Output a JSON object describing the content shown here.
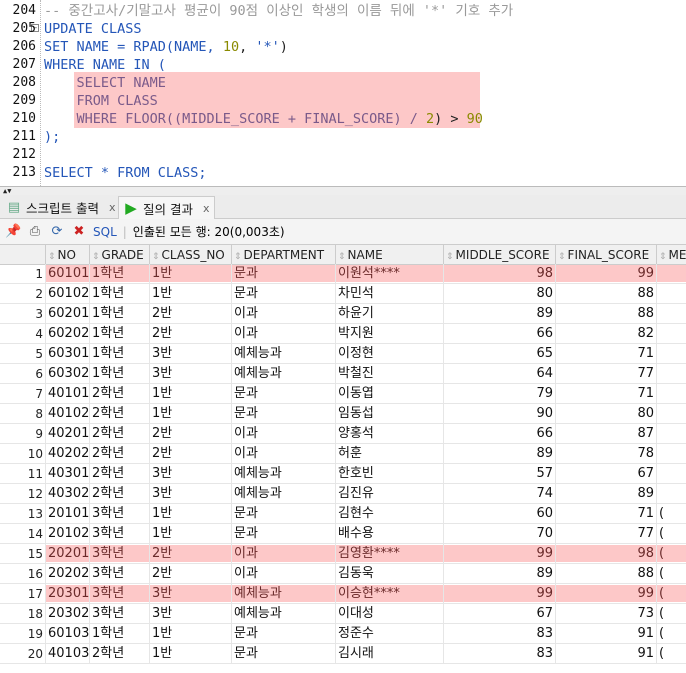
{
  "editor": {
    "lines": [
      {
        "n": "204",
        "text": "-- 중간고사/기말고사 평균이 90점 이상인 학생의 이름 뒤에 '*' 기호 추가"
      },
      {
        "n": "205",
        "text": "UPDATE CLASS"
      },
      {
        "n": "206",
        "a": "SET NAME = RPAD(NAME, ",
        "b": "10",
        ",": ", ",
        "c": "'*'",
        "d": ")"
      },
      {
        "n": "207",
        "text": "WHERE NAME IN ("
      },
      {
        "n": "208",
        "text": "    SELECT NAME"
      },
      {
        "n": "209",
        "text": "    FROM CLASS"
      },
      {
        "n": "210",
        "a": "    WHERE FLOOR((MIDDLE_SCORE + FINAL_SCORE) / ",
        "b": "2",
        ",": ") > ",
        "c": "90"
      },
      {
        "n": "211",
        "text": ");"
      },
      {
        "n": "212",
        "text": ""
      },
      {
        "n": "213",
        "text": "SELECT * FROM CLASS;"
      }
    ],
    "highlight_color": "#fdc8c8"
  },
  "tabs": [
    {
      "label": "스크립트 출력",
      "icon": "script-output-icon",
      "close": "x"
    },
    {
      "label": "질의 결과",
      "icon": "run-icon",
      "close": "x",
      "active": true
    }
  ],
  "toolbar": {
    "sql_label": "SQL",
    "status": "인출된 모든 행: 20(0,003초)"
  },
  "grid": {
    "columns": [
      "NO",
      "GRADE",
      "CLASS_NO",
      "DEPARTMENT",
      "NAME",
      "MIDDLE_SCORE",
      "FINAL_SCORE",
      "ME"
    ],
    "rows": [
      [
        "1",
        "60101",
        "1학년",
        "1반",
        "문과",
        "이원석****",
        "98",
        "99",
        ""
      ],
      [
        "2",
        "60102",
        "1학년",
        "1반",
        "문과",
        "차민석",
        "80",
        "88",
        ""
      ],
      [
        "3",
        "60201",
        "1학년",
        "2반",
        "이과",
        "하윤기",
        "89",
        "88",
        ""
      ],
      [
        "4",
        "60202",
        "1학년",
        "2반",
        "이과",
        "박지원",
        "66",
        "82",
        ""
      ],
      [
        "5",
        "60301",
        "1학년",
        "3반",
        "예체능과",
        "이정현",
        "65",
        "71",
        ""
      ],
      [
        "6",
        "60302",
        "1학년",
        "3반",
        "예체능과",
        "박철진",
        "64",
        "77",
        ""
      ],
      [
        "7",
        "40101",
        "2학년",
        "1반",
        "문과",
        "이동엽",
        "79",
        "71",
        ""
      ],
      [
        "8",
        "40102",
        "2학년",
        "1반",
        "문과",
        "임동섭",
        "90",
        "80",
        ""
      ],
      [
        "9",
        "40201",
        "2학년",
        "2반",
        "이과",
        "양홍석",
        "66",
        "87",
        ""
      ],
      [
        "10",
        "40202",
        "2학년",
        "2반",
        "이과",
        "허훈",
        "89",
        "78",
        ""
      ],
      [
        "11",
        "40301",
        "2학년",
        "3반",
        "예체능과",
        "한호빈",
        "57",
        "67",
        ""
      ],
      [
        "12",
        "40302",
        "2학년",
        "3반",
        "예체능과",
        "김진유",
        "74",
        "89",
        ""
      ],
      [
        "13",
        "20101",
        "3학년",
        "1반",
        "문과",
        "김현수",
        "60",
        "71",
        "("
      ],
      [
        "14",
        "20102",
        "3학년",
        "1반",
        "문과",
        "배수용",
        "70",
        "77",
        "("
      ],
      [
        "15",
        "20201",
        "3학년",
        "2반",
        "이과",
        "김영환****",
        "99",
        "98",
        "("
      ],
      [
        "16",
        "20202",
        "3학년",
        "2반",
        "이과",
        "김동욱",
        "89",
        "88",
        "("
      ],
      [
        "17",
        "20301",
        "3학년",
        "3반",
        "예체능과",
        "이승현****",
        "99",
        "99",
        "("
      ],
      [
        "18",
        "20302",
        "3학년",
        "3반",
        "예체능과",
        "이대성",
        "67",
        "73",
        "("
      ],
      [
        "19",
        "60103",
        "1학년",
        "1반",
        "문과",
        "정준수",
        "83",
        "91",
        "("
      ],
      [
        "20",
        "40103",
        "2학년",
        "1반",
        "문과",
        "김시래",
        "83",
        "91",
        "("
      ]
    ],
    "highlighted_rows": [
      1,
      15,
      17
    ]
  }
}
